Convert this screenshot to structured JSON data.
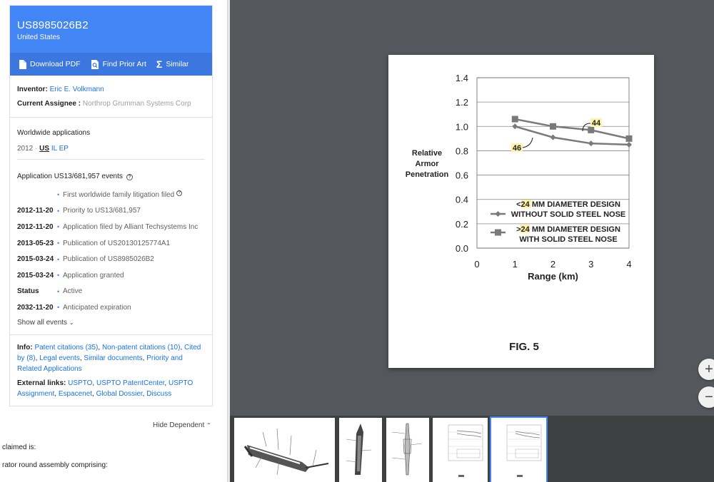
{
  "patent": {
    "number": "US8985026B2",
    "country": "United States"
  },
  "actions": {
    "download": "Download PDF",
    "prior_art": "Find Prior Art",
    "similar": "Similar"
  },
  "people": {
    "inventor_label": "Inventor:",
    "inventor": "Eric E. Volkmann",
    "assignee_label": "Current Assignee :",
    "assignee": "Northrop Grumman Systems Corp"
  },
  "worldwide": {
    "title": "Worldwide applications",
    "year": "2012",
    "sep": "·",
    "countries": [
      "US",
      "IL",
      "EP"
    ]
  },
  "events": {
    "title": "Application US13/681,957 events",
    "items": [
      {
        "date": "",
        "text": "First worldwide family litigation filed"
      },
      {
        "date": "2012-11-20",
        "text": "Priority to US13/681,957"
      },
      {
        "date": "2012-11-20",
        "text": "Application filed by Alliant Techsystems Inc"
      },
      {
        "date": "2013-05-23",
        "text": "Publication of US20130125774A1"
      },
      {
        "date": "2015-03-24",
        "text": "Publication of US8985026B2"
      },
      {
        "date": "2015-03-24",
        "text": "Application granted"
      },
      {
        "date": "Status",
        "text": "Active"
      },
      {
        "date": "2032-11-20",
        "text": "Anticipated expiration"
      }
    ],
    "show_all": "Show all events"
  },
  "info": {
    "label": "Info:",
    "links": [
      "Patent citations (35)",
      "Non-patent citations (10)",
      "Cited by (8)",
      "Legal events",
      "Similar documents",
      "Priority and Related Applications"
    ],
    "external_label": "External links:",
    "external": [
      "USPTO",
      "USPTO PatentCenter",
      "USPTO Assignment",
      "Espacenet",
      "Global Dossier",
      "Discuss"
    ]
  },
  "claims": {
    "hide": "Hide Dependent",
    "line1": "claimed is:",
    "line2": "rator round assembly comprising:"
  },
  "colors": {
    "header": "#4285f4",
    "actions_bar": "#3b77de",
    "link": "#1a73e8",
    "viewer_bg": "#54575b"
  },
  "chart_data": {
    "type": "line",
    "ylabel": "Relative Armor Penetration",
    "xlabel": "Range (km)",
    "ylim": [
      0.0,
      1.4
    ],
    "xlim": [
      0,
      4
    ],
    "yticks": [
      "0.0",
      "0.2",
      "0.4",
      "0.6",
      "0.8",
      "1.0",
      "1.2",
      "1.4"
    ],
    "xticks": [
      "0",
      "1",
      "2",
      "3",
      "4"
    ],
    "grid": true,
    "series": [
      {
        "name": "< 24 MM DIAMETER DESIGN WITHOUT SOLID STEEL NOSE",
        "label": "46",
        "marker": "diamond",
        "x": [
          1,
          2,
          3,
          4
        ],
        "y": [
          1.0,
          0.91,
          0.86,
          0.85
        ]
      },
      {
        "name": "> 24 MM DIAMETER DESIGN WITH SOLID STEEL NOSE",
        "label": "44",
        "marker": "square",
        "x": [
          1,
          2,
          3,
          4
        ],
        "y": [
          1.06,
          1.0,
          0.97,
          0.9
        ]
      }
    ],
    "legend": [
      {
        "prefix": "<",
        "num": "24",
        "line1": "MM DIAMETER DESIGN",
        "line2": "WITHOUT SOLID STEEL NOSE"
      },
      {
        "prefix": ">",
        "num": "24",
        "line1": "MM DIAMETER DESIGN",
        "line2": "WITH SOLID STEEL NOSE"
      }
    ],
    "ylabel_lines": [
      "Relative",
      "Armor",
      "Penetration"
    ],
    "fig_label": "FIG. 5"
  },
  "zoom": {
    "in": "+",
    "out": "−"
  }
}
